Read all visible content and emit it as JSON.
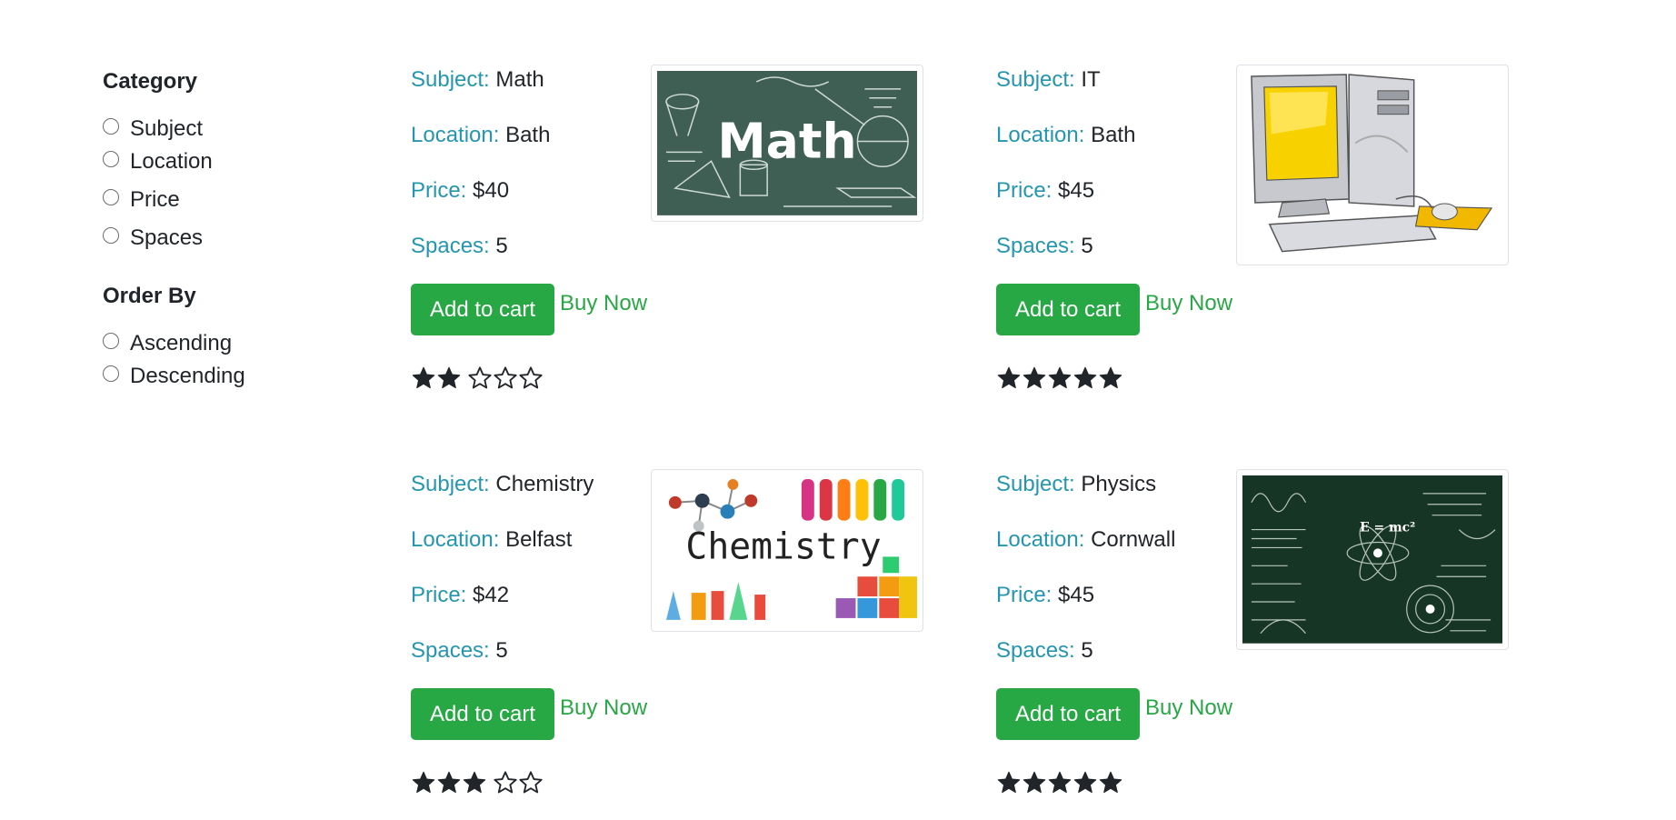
{
  "sidebar": {
    "category_heading": "Category",
    "category_options": [
      "Subject",
      "Location",
      "Price",
      "Spaces"
    ],
    "order_heading": "Order By",
    "order_options": [
      "Ascending",
      "Descending"
    ]
  },
  "labels": {
    "subject": "Subject:",
    "location": "Location:",
    "price": "Price:",
    "spaces": "Spaces:",
    "add_to_cart": "Add to cart",
    "buy_now": "Buy Now"
  },
  "lessons": [
    {
      "subject": "Math",
      "location": "Bath",
      "price": "$40",
      "spaces": "5",
      "rating": 2,
      "image": "math-chalkboard",
      "image_text": "Math"
    },
    {
      "subject": "IT",
      "location": "Bath",
      "price": "$45",
      "spaces": "5",
      "rating": 5,
      "image": "desktop-computer"
    },
    {
      "subject": "Chemistry",
      "location": "Belfast",
      "price": "$42",
      "spaces": "5",
      "rating": 3,
      "image": "chemistry-lab",
      "image_text": "Chemistry"
    },
    {
      "subject": "Physics",
      "location": "Cornwall",
      "price": "$45",
      "spaces": "5",
      "rating": 5,
      "image": "physics-chalkboard",
      "image_text": "E = mc²"
    }
  ],
  "colors": {
    "label": "#2596b0",
    "button": "#28a745",
    "star": "#212529"
  },
  "rating_max": 5
}
